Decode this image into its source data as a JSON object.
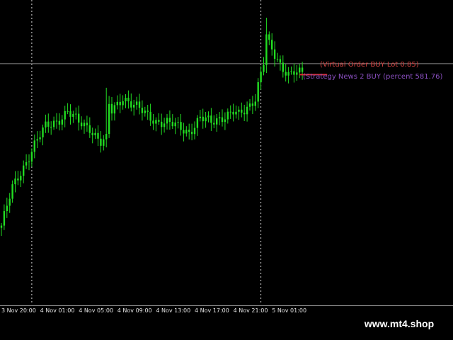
{
  "theme": {
    "background": "#000000",
    "candle": "#22dd22",
    "grid": "#d8d8d8",
    "hline": "#8a8a8a",
    "order_line": "#e03030",
    "text": "#e6e6e6"
  },
  "watermark": "www.mt4.shop",
  "overlays": [
    {
      "text": "(Virtual Order BUY Lot 0.85)",
      "color": "#d24040"
    },
    {
      "text": "(Strategy News 2 BUY (percent 581.76)",
      "color": "#8a4fc0"
    }
  ],
  "chart_data": {
    "type": "candlestick",
    "x_ticks": [
      "3 Nov 20:00",
      "4 Nov 01:00",
      "4 Nov 05:00",
      "4 Nov 09:00",
      "4 Nov 13:00",
      "4 Nov 17:00",
      "4 Nov 21:00",
      "5 Nov 01:00"
    ],
    "x_tick_positions": [
      0,
      14,
      28,
      42,
      56,
      70,
      84,
      98
    ],
    "separators": [
      11,
      94
    ],
    "hline_level": 0.79,
    "order_level": 0.74,
    "ylim": [
      0,
      1
    ],
    "close_anchors": [
      [
        0,
        0.05
      ],
      [
        4,
        0.22
      ],
      [
        8,
        0.32
      ],
      [
        12,
        0.42
      ],
      [
        16,
        0.5
      ],
      [
        20,
        0.53
      ],
      [
        24,
        0.57
      ],
      [
        28,
        0.52
      ],
      [
        32,
        0.5
      ],
      [
        36,
        0.43
      ],
      [
        38,
        0.44
      ],
      [
        39,
        0.6
      ],
      [
        40,
        0.57
      ],
      [
        44,
        0.64
      ],
      [
        48,
        0.6
      ],
      [
        52,
        0.56
      ],
      [
        56,
        0.53
      ],
      [
        60,
        0.52
      ],
      [
        64,
        0.5
      ],
      [
        68,
        0.48
      ],
      [
        72,
        0.54
      ],
      [
        76,
        0.52
      ],
      [
        80,
        0.55
      ],
      [
        84,
        0.57
      ],
      [
        86,
        0.55
      ],
      [
        88,
        0.57
      ],
      [
        90,
        0.6
      ],
      [
        92,
        0.64
      ],
      [
        93,
        0.7
      ],
      [
        95,
        0.8
      ],
      [
        96,
        0.92
      ],
      [
        97,
        0.87
      ],
      [
        99,
        0.82
      ],
      [
        101,
        0.78
      ],
      [
        104,
        0.75
      ],
      [
        106,
        0.76
      ],
      [
        109,
        0.74
      ]
    ],
    "high_events": [
      [
        38,
        0.68
      ],
      [
        96,
        1.0
      ]
    ]
  }
}
